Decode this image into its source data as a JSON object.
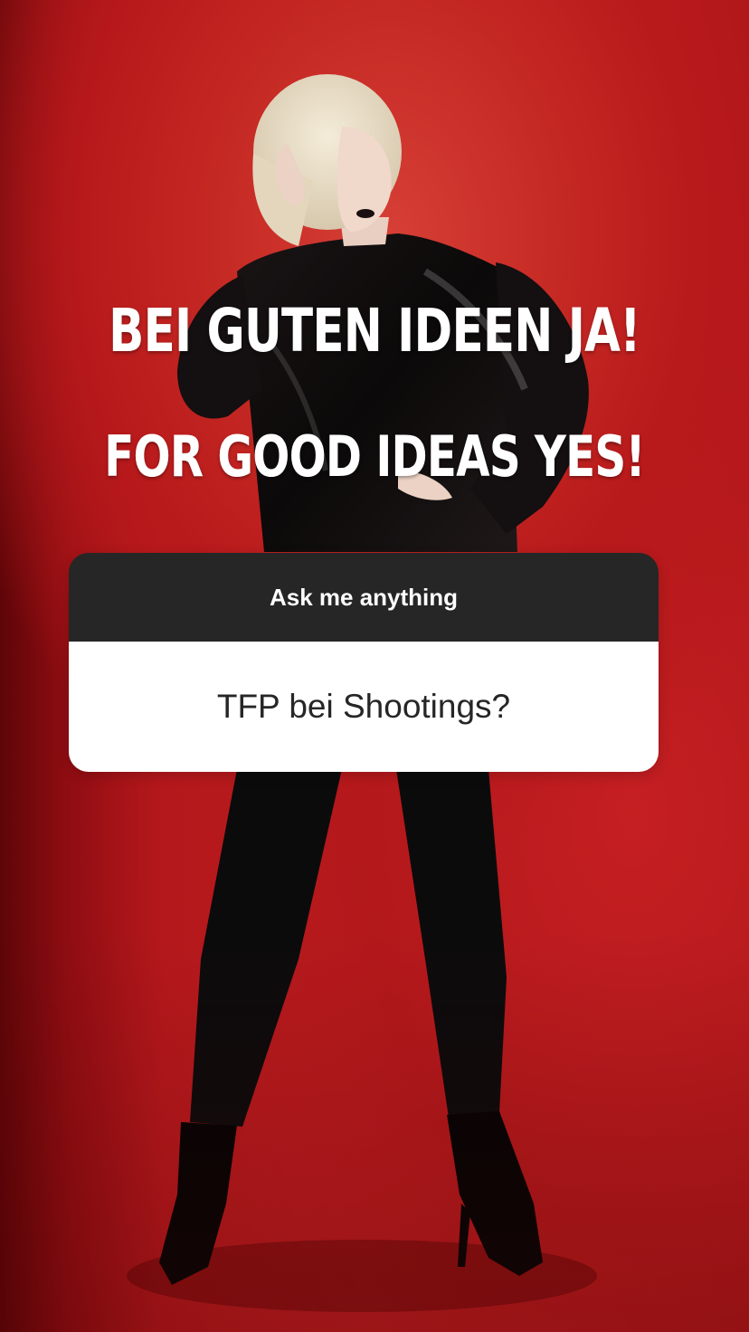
{
  "story": {
    "headline_de": "BEI GUTEN IDEEN JA!",
    "headline_en": "FOR GOOD IDEAS YES!"
  },
  "question_sticker": {
    "prompt": "Ask me anything",
    "question": "TFP bei Shootings?"
  },
  "colors": {
    "background": "#c21f22",
    "sticker_header": "#262626",
    "sticker_body": "#ffffff",
    "text_light": "#ffffff",
    "text_dark": "#262626"
  }
}
